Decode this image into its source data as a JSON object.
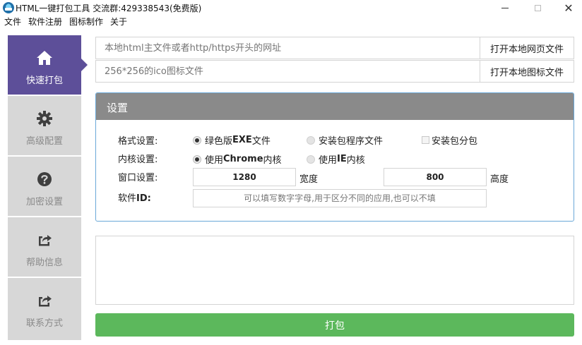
{
  "window": {
    "title": "HTML一键打包工具 交流群:429338543(免费版)"
  },
  "menu": [
    "文件",
    "软件注册",
    "图标制作",
    "关于"
  ],
  "sidebar": {
    "items": [
      {
        "label": "快速打包",
        "icon": "home-icon",
        "active": true
      },
      {
        "label": "高级配置",
        "icon": "gear-icon",
        "active": false
      },
      {
        "label": "加密设置",
        "icon": "question-icon",
        "active": false
      },
      {
        "label": "帮助信息",
        "icon": "share-icon",
        "active": false
      },
      {
        "label": "联系方式",
        "icon": "share-icon",
        "active": false
      }
    ]
  },
  "source": {
    "url_placeholder": "本地html主文件或者http/https开头的网址",
    "url_value": "",
    "open_web_label": "打开本地网页文件",
    "icon_placeholder": "256*256的ico图标文件",
    "icon_value": "",
    "open_icon_label": "打开本地图标文件"
  },
  "settings": {
    "title": "设置",
    "format_label": "格式设置:",
    "format_options": {
      "green_prefix": "绿色版",
      "green_bold": "EXE",
      "green_suffix": "文件",
      "installer": "安装包程序文件",
      "split": "安装包分包"
    },
    "format_selected": "green",
    "kernel_label": "内核设置:",
    "kernel_options": {
      "chrome_prefix": "使用",
      "chrome_bold": "Chrome",
      "chrome_suffix": "内核",
      "ie_prefix": "使用",
      "ie_bold": "IE",
      "ie_suffix": "内核"
    },
    "kernel_selected": "chrome",
    "window_label": "窗口设置:",
    "width_value": "1280",
    "width_unit": "宽度",
    "height_value": "800",
    "height_unit": "高度",
    "id_label_prefix": "软件",
    "id_label_bold": "ID:",
    "id_placeholder": "可以填写数字字母,用于区分不同的应用,也可以不填"
  },
  "log": {
    "value": ""
  },
  "actions": {
    "pack_label": "打包"
  },
  "colors": {
    "sidebar_active": "#5d4f99",
    "sidebar_inactive": "#d7d7d7",
    "panel_header": "#8a8a8a",
    "panel_border": "#6aa8d8",
    "pack_button": "#5cb85c"
  }
}
